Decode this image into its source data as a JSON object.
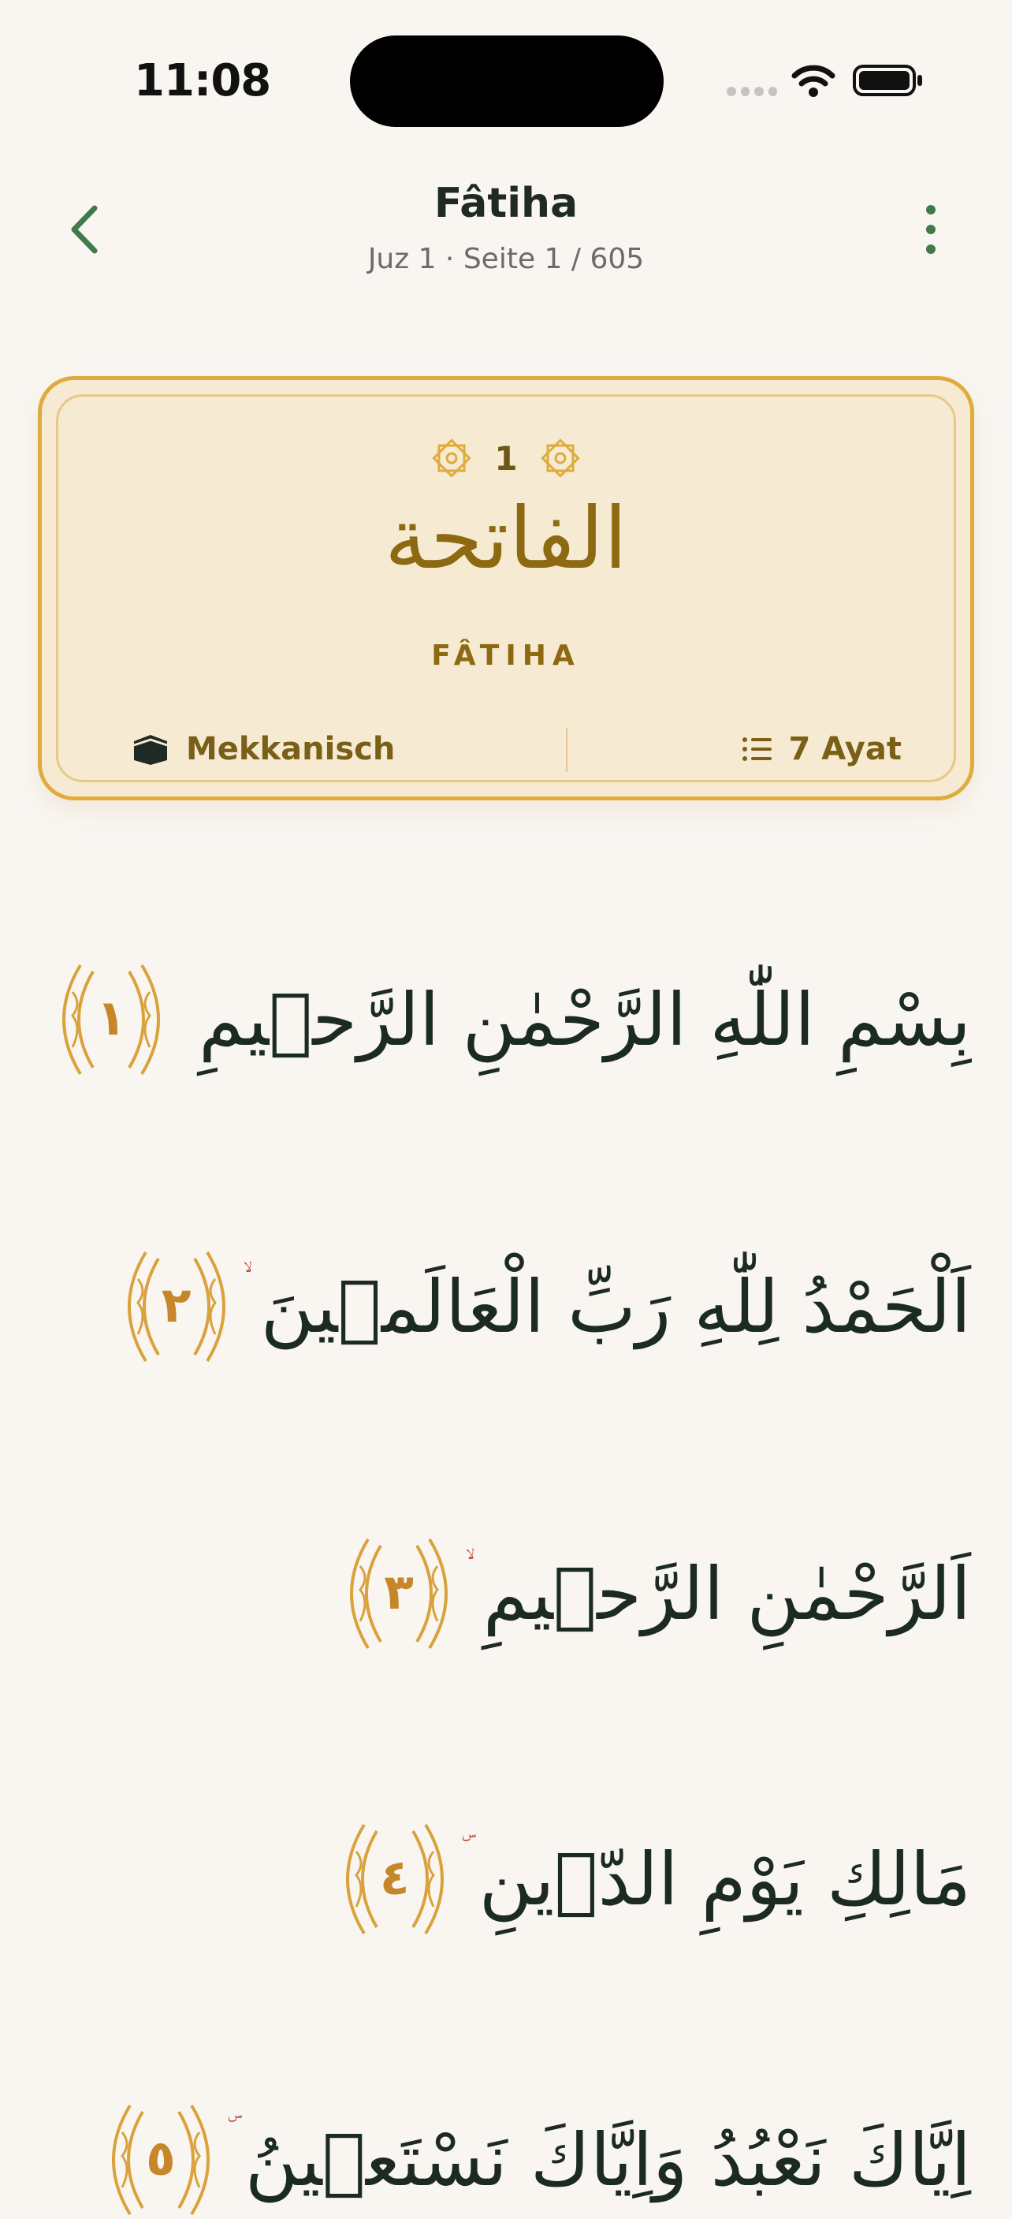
{
  "status": {
    "time": "11:08"
  },
  "header": {
    "title": "Fâtiha",
    "subtitle": "Juz 1 · Seite 1 / 605"
  },
  "card": {
    "number": "1",
    "arabic_name": "الفاتحة",
    "latin_name": "FÂTIHA",
    "revelation": "Mekkanisch",
    "ayat_count": "7 Ayat"
  },
  "verses": [
    {
      "text": "بِسْمِ اللّٰهِ الرَّحْمٰنِ الرَّح۪يمِ",
      "number": "١",
      "pause": ""
    },
    {
      "text": "اَلْحَمْدُ لِلّٰهِ رَبِّ الْعَالَم۪ينَ",
      "number": "٢",
      "pause": "ۙ"
    },
    {
      "text": "اَلرَّحْمٰنِ الرَّح۪يمِ",
      "number": "٣",
      "pause": "ۙ"
    },
    {
      "text": "مَالِكِ يَوْمِ الدّ۪ينِ",
      "number": "٤",
      "pause": "ۜ"
    },
    {
      "text": "اِيَّاكَ نَعْبُدُ وَاِيَّاكَ نَسْتَع۪ينُ",
      "number": "٥",
      "pause": "ۜ"
    }
  ],
  "colors": {
    "accent": "#e0ab3d",
    "gold": "#c5872a",
    "nav": "#3f7a4a"
  }
}
